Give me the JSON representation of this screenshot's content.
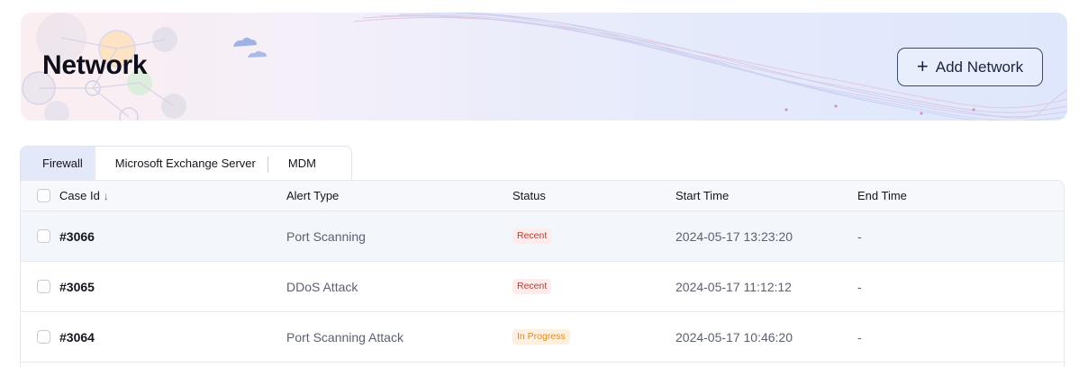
{
  "header": {
    "title": "Network",
    "add_button_label": "Add Network",
    "add_button_icon": "plus-icon"
  },
  "tabs": [
    {
      "label": "Firewall",
      "active": true
    },
    {
      "label": "Microsoft Exchange Server",
      "active": false
    },
    {
      "label": "MDM",
      "active": false
    }
  ],
  "table": {
    "columns": [
      "Case Id",
      "Alert Type",
      "Status",
      "Start Time",
      "End Time"
    ],
    "sort_icon": "arrow-down-icon",
    "rows": [
      {
        "case_id": "#3066",
        "alert_type": "Port Scanning",
        "status": "Recent",
        "start_time": "2024-05-17 13:23:20",
        "end_time": "-"
      },
      {
        "case_id": "#3065",
        "alert_type": "DDoS Attack",
        "status": "Recent",
        "start_time": "2024-05-17 11:12:12",
        "end_time": "-"
      },
      {
        "case_id": "#3064",
        "alert_type": "Port Scanning Attack",
        "status": "In Progress",
        "start_time": "2024-05-17 10:46:20",
        "end_time": "-"
      }
    ]
  },
  "colors": {
    "status_recent_bg": "#fdeceb",
    "status_recent_text": "#c0392b",
    "status_progress_bg": "#fdf0e1",
    "status_progress_text": "#e08a1e",
    "active_tab_bg": "#e3e9f8"
  }
}
